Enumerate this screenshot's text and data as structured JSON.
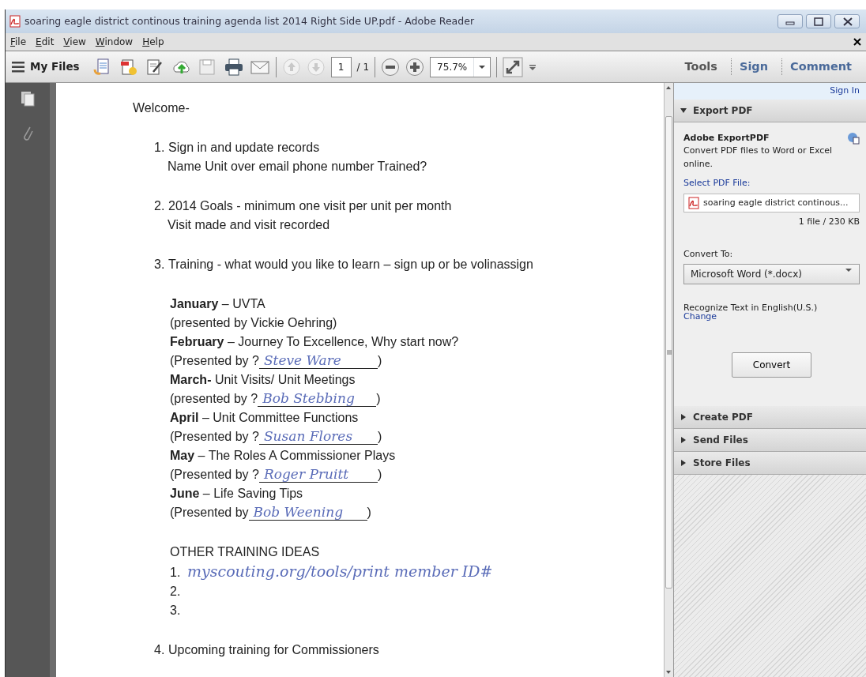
{
  "window": {
    "title": "soaring eagle district continous training agenda list 2014 Right Side UP.pdf - Adobe Reader"
  },
  "menu": [
    "File",
    "Edit",
    "View",
    "Window",
    "Help"
  ],
  "toolbar": {
    "my_files": "My Files",
    "page_up": {
      "disabled": true
    },
    "page_down": {
      "disabled": true
    },
    "page": "1",
    "page_total": "/ 1",
    "zoom": "75.7%",
    "panes": [
      {
        "label": "Tools",
        "kind": "tools"
      },
      {
        "label": "Sign",
        "kind": "pane"
      },
      {
        "label": "Comment",
        "kind": "pane"
      }
    ]
  },
  "document": {
    "blocks": [
      {
        "lines": [
          {
            "kind": "title",
            "text": "Welcome-"
          }
        ]
      },
      {
        "lines": [
          {
            "kind": "item",
            "number": "1.",
            "text": "Sign in and update records"
          },
          {
            "kind": "continuation",
            "text": "Name   Unit over   email   phone number  Trained?"
          }
        ]
      },
      {
        "lines": [
          {
            "kind": "item",
            "number": "2.",
            "text": "2014 Goals  -  minimum one visit per unit per month"
          },
          {
            "kind": "continuation",
            "text": "Visit made and visit recorded"
          }
        ]
      },
      {
        "lines": [
          {
            "kind": "item",
            "number": "3.",
            "text": "Training -  what would you like to learn – sign up or be volinassign"
          }
        ]
      },
      {
        "lines": [
          {
            "kind": "month",
            "text": "**January** – UVTA"
          },
          {
            "kind": "month",
            "text": "(presented by Vickie Oehring)"
          },
          {
            "kind": "month",
            "text": "**February** – Journey To Excellence, Why start now?"
          },
          {
            "kind": "presenter",
            "prefix": "(Presented by ?",
            "handwriting": "Steve Ware",
            "suffix": ")"
          },
          {
            "kind": "month",
            "text": "**March-** Unit Visits/ Unit Meetings"
          },
          {
            "kind": "presenter",
            "prefix": "(presented by ?",
            "handwriting": "Bob Stebbing",
            "suffix": ")"
          },
          {
            "kind": "month",
            "text": "**April** – Unit Committee Functions"
          },
          {
            "kind": "presenter",
            "prefix": "(Presented by ?",
            "handwriting": "Susan Flores",
            "suffix": ")"
          },
          {
            "kind": "month",
            "text": "**May** – The Roles A Commissioner Plays"
          },
          {
            "kind": "presenter",
            "prefix": "(Presented by ?",
            "handwriting": "Roger Pruitt",
            "suffix": ")"
          },
          {
            "kind": "month",
            "text": "**June** – Life Saving Tips"
          },
          {
            "kind": "presenter",
            "prefix": "(Presented by",
            "handwriting": "Bob Weening",
            "suffix": ")"
          }
        ]
      },
      {
        "lines": [
          {
            "kind": "month",
            "text": "OTHER TRAINING IDEAS"
          },
          {
            "kind": "idea",
            "number": "1.",
            "handwriting": "myscouting.org/tools/print member ID#"
          },
          {
            "kind": "idea",
            "number": "2."
          },
          {
            "kind": "idea",
            "number": "3."
          }
        ]
      },
      {
        "lines": [
          {
            "kind": "item",
            "number": "4.",
            "text": "Upcoming training for Commissioners"
          }
        ]
      }
    ]
  },
  "right_pane": {
    "sign_in": "Sign In",
    "sections": [
      {
        "title": "Export PDF",
        "expanded": true,
        "content": {
          "heading": "Adobe ExportPDF",
          "description": "Convert PDF files to Word or Excel online.",
          "select_label": "Select PDF File:",
          "file_name": "soaring eagle district continous...",
          "file_info": "1 file / 230 KB",
          "convert_label": "Convert To:",
          "convert_to": "Microsoft Word (*.docx)",
          "ocr_text": "Recognize Text in English(U.S.)",
          "change_link": "Change",
          "button": "Convert"
        }
      },
      {
        "title": "Create PDF",
        "expanded": false
      },
      {
        "title": "Send Files",
        "expanded": false
      },
      {
        "title": "Store Files",
        "expanded": false
      }
    ]
  }
}
